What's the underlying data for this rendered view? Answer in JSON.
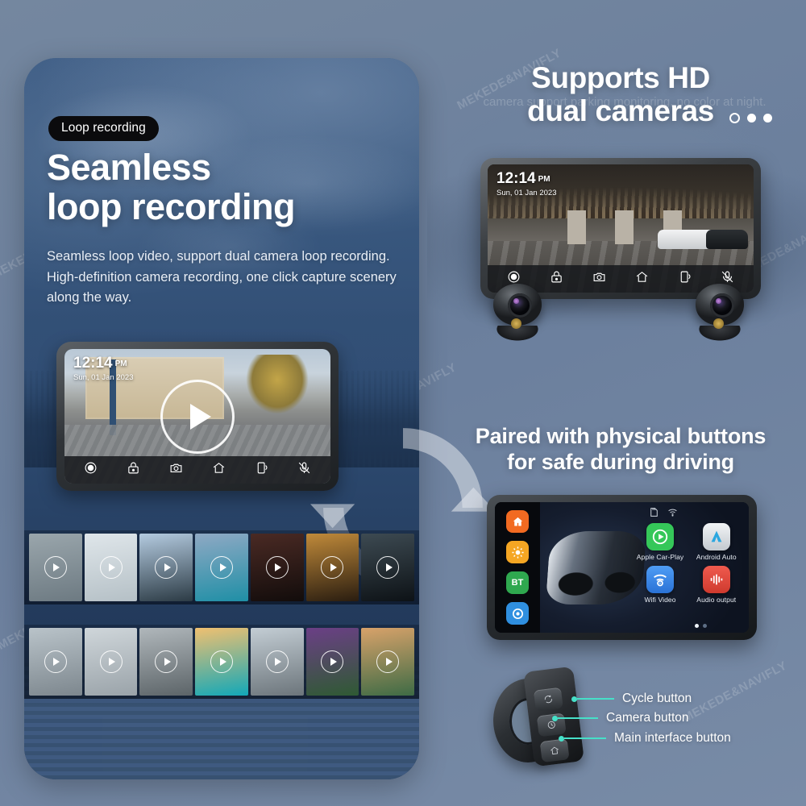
{
  "theme": {
    "background": "#6e82a0",
    "left_card_bg": "#33527a",
    "accent_teal": "#46e0c8",
    "badge_bg": "#0b0b0d",
    "text_white": "#ffffff"
  },
  "watermark": {
    "text": "MEKEDE&NAVIFLY"
  },
  "left_panel": {
    "badge": "Loop recording",
    "dots": [
      "hollow",
      "filled",
      "filled"
    ],
    "headline_line1": "Seamless",
    "headline_line2": "loop recording",
    "body": "Seamless loop video, support dual camera loop recording. High-definition camera recording, one click capture scenery along the way.",
    "device_screen": {
      "time": "12:14",
      "meridiem": "PM",
      "date": "Sun, 01 Jan 2023",
      "toolbar_icons": [
        "record-icon",
        "lock-icon",
        "camera-icon",
        "home-icon",
        "phone-icon",
        "mic-off-icon"
      ],
      "play_overlay": "play-icon",
      "loop_overlay": "loop-arrows-icon"
    },
    "filmstrip_top": [
      {
        "name": "forest-snow",
        "c1": "#9aa6ac",
        "c2": "#6d7a82"
      },
      {
        "name": "snowy-trees",
        "c1": "#dfe6ea",
        "c2": "#b5c0c6"
      },
      {
        "name": "lake-dock",
        "c1": "#b4cbe0",
        "c2": "#2c3b45"
      },
      {
        "name": "ocean-sunset",
        "c1": "#8fa9c4",
        "c2": "#1f8fa6"
      },
      {
        "name": "tunnel-red",
        "c1": "#4a2a24",
        "c2": "#120c0b"
      },
      {
        "name": "tunnel-amber",
        "c1": "#c08a3a",
        "c2": "#2a1d10"
      },
      {
        "name": "tunnel-night",
        "c1": "#3d4a52",
        "c2": "#0d1216"
      }
    ],
    "filmstrip_bottom": [
      {
        "name": "rain-traffic",
        "c1": "#b9c3c9",
        "c2": "#7d878e"
      },
      {
        "name": "fog-road",
        "c1": "#cfd6da",
        "c2": "#9aa3a9"
      },
      {
        "name": "snow-highway",
        "c1": "#b0b7bb",
        "c2": "#5c6468"
      },
      {
        "name": "tropical-sea",
        "c1": "#f0c070",
        "c2": "#12a8b8"
      },
      {
        "name": "open-road",
        "c1": "#c3cdd4",
        "c2": "#6c757b"
      },
      {
        "name": "purple-hills",
        "c1": "#6b3f86",
        "c2": "#2f5a33"
      },
      {
        "name": "green-valley",
        "c1": "#d8a26a",
        "c2": "#3e6b45"
      }
    ]
  },
  "right_panel": {
    "title_hd": "Supports HD\ndual cameras",
    "title_hd_l1": "Supports HD",
    "title_hd_l2": "dual cameras",
    "ghost_text": "camera support parking monitoring, no color at night.",
    "title_buttons_l1": "Paired with physical buttons",
    "title_buttons_l2": "for safe during driving",
    "dual_cam_device": {
      "time": "12:14",
      "meridiem": "PM",
      "date": "Sun, 01 Jan 2023",
      "toolbar_icons": [
        "record-icon",
        "lock-icon",
        "camera-icon",
        "home-icon",
        "phone-icon",
        "mic-off-icon"
      ],
      "cameras": [
        "front-camera",
        "rear-camera"
      ]
    },
    "carplay_device": {
      "rail_icons": [
        {
          "name": "home-icon",
          "label": "",
          "color": "#f26a21"
        },
        {
          "name": "brightness-icon",
          "label": "",
          "color": "#f5a623"
        },
        {
          "name": "bluetooth-icon",
          "label": "BT",
          "color": "#2fa84f"
        },
        {
          "name": "settings-icon",
          "label": "",
          "color": "#2f8fe0"
        }
      ],
      "status_icons": [
        "sd-card-icon",
        "wifi-icon"
      ],
      "apps": [
        {
          "label": "Apple Car-Play",
          "icon": "carplay-icon",
          "color": "#35c759"
        },
        {
          "label": "Android Auto",
          "icon": "android-auto-icon",
          "color": "#d8dde2"
        },
        {
          "label": "Wifi Video",
          "icon": "wifi-video-icon",
          "color": "#3b8ef0"
        },
        {
          "label": "Audio output",
          "icon": "audio-output-icon",
          "color": "#e0483c"
        }
      ],
      "page_dots": [
        "on",
        "off"
      ],
      "wallpaper": "motorcycle-wallpaper"
    },
    "remote": {
      "buttons": [
        {
          "icon": "cycle-icon",
          "label": "Cycle button"
        },
        {
          "icon": "camera-icon",
          "label": "Camera button"
        },
        {
          "icon": "home-icon",
          "label": "Main interface button"
        }
      ]
    }
  }
}
